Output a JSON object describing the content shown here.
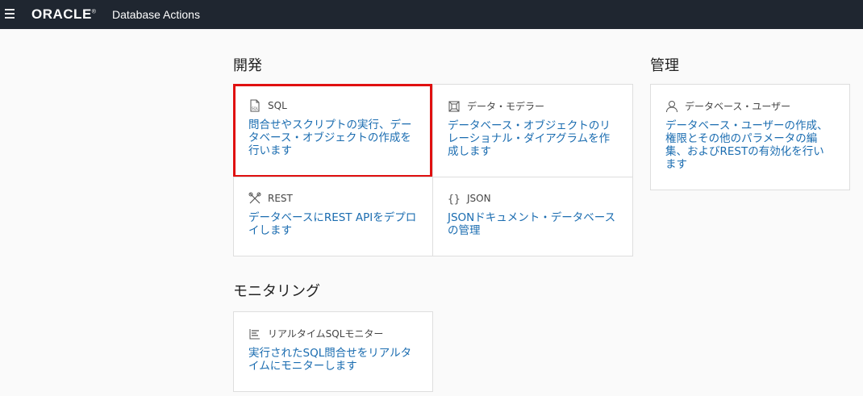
{
  "header": {
    "brand": "ORACLE",
    "product": "Database Actions"
  },
  "sections": {
    "development": "開発",
    "management": "管理",
    "monitoring": "モニタリング"
  },
  "cards": {
    "sql": {
      "label": "SQL",
      "desc": "問合せやスクリプトの実行、データベース・オブジェクトの作成を行います",
      "icon": "sql-file-icon"
    },
    "data_modeler": {
      "label": "データ・モデラー",
      "desc": "データベース・オブジェクトのリレーショナル・ダイアグラムを作成します",
      "icon": "data-modeler-icon"
    },
    "rest": {
      "label": "REST",
      "desc": "データベースにREST APIをデプロイします",
      "icon": "tools-icon"
    },
    "json": {
      "label": "JSON",
      "desc": "JSONドキュメント・データベースの管理",
      "icon": "braces-icon"
    },
    "db_users": {
      "label": "データベース・ユーザー",
      "desc": "データベース・ユーザーの作成、権限とその他のパラメータの編集、およびRESTの有効化を行います",
      "icon": "user-icon"
    },
    "sql_monitor": {
      "label": "リアルタイムSQLモニター",
      "desc": "実行されたSQL問合せをリアルタイムにモニターします",
      "icon": "monitor-bars-icon"
    }
  },
  "colors": {
    "topbar": "#1f2630",
    "link": "#1a6cb0",
    "selected_border": "#e01010"
  }
}
